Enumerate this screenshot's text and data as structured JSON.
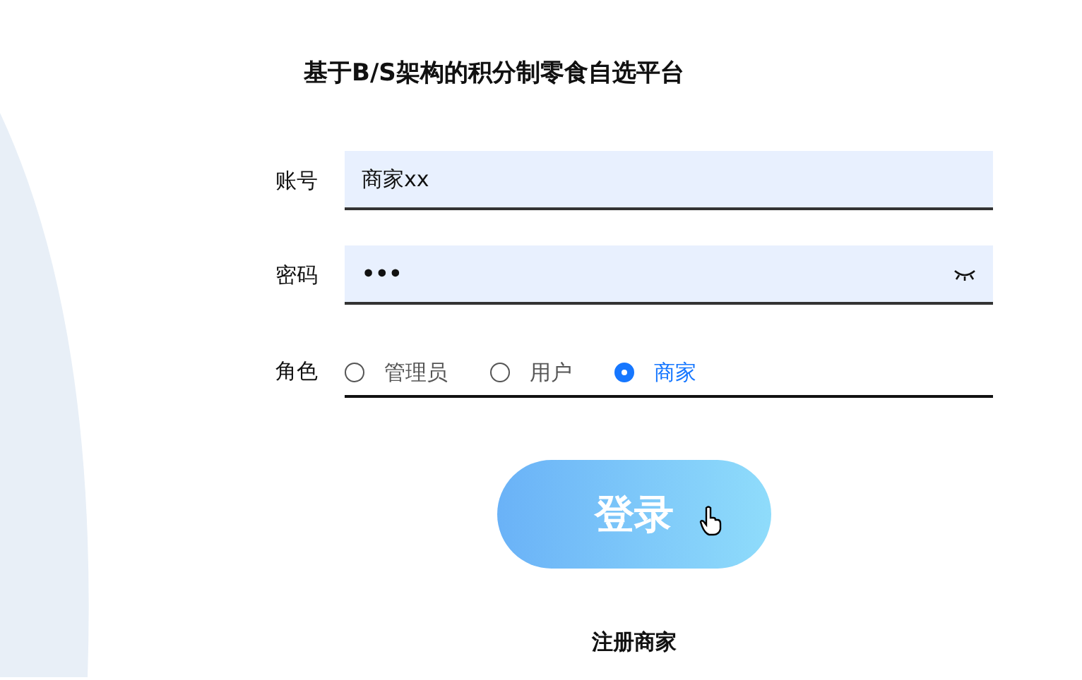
{
  "title": "基于B/S架构的积分制零食自选平台",
  "fields": [
    {
      "label": "账号",
      "kind": "text",
      "value": "商家xx"
    },
    {
      "label": "密码",
      "kind": "password",
      "value": "•••"
    }
  ],
  "role": {
    "label": "角色",
    "options": [
      {
        "label": "管理员",
        "selected": false
      },
      {
        "label": "用户",
        "selected": false
      },
      {
        "label": "商家",
        "selected": true
      }
    ]
  },
  "login_button": "登录",
  "register_link": "注册商家"
}
